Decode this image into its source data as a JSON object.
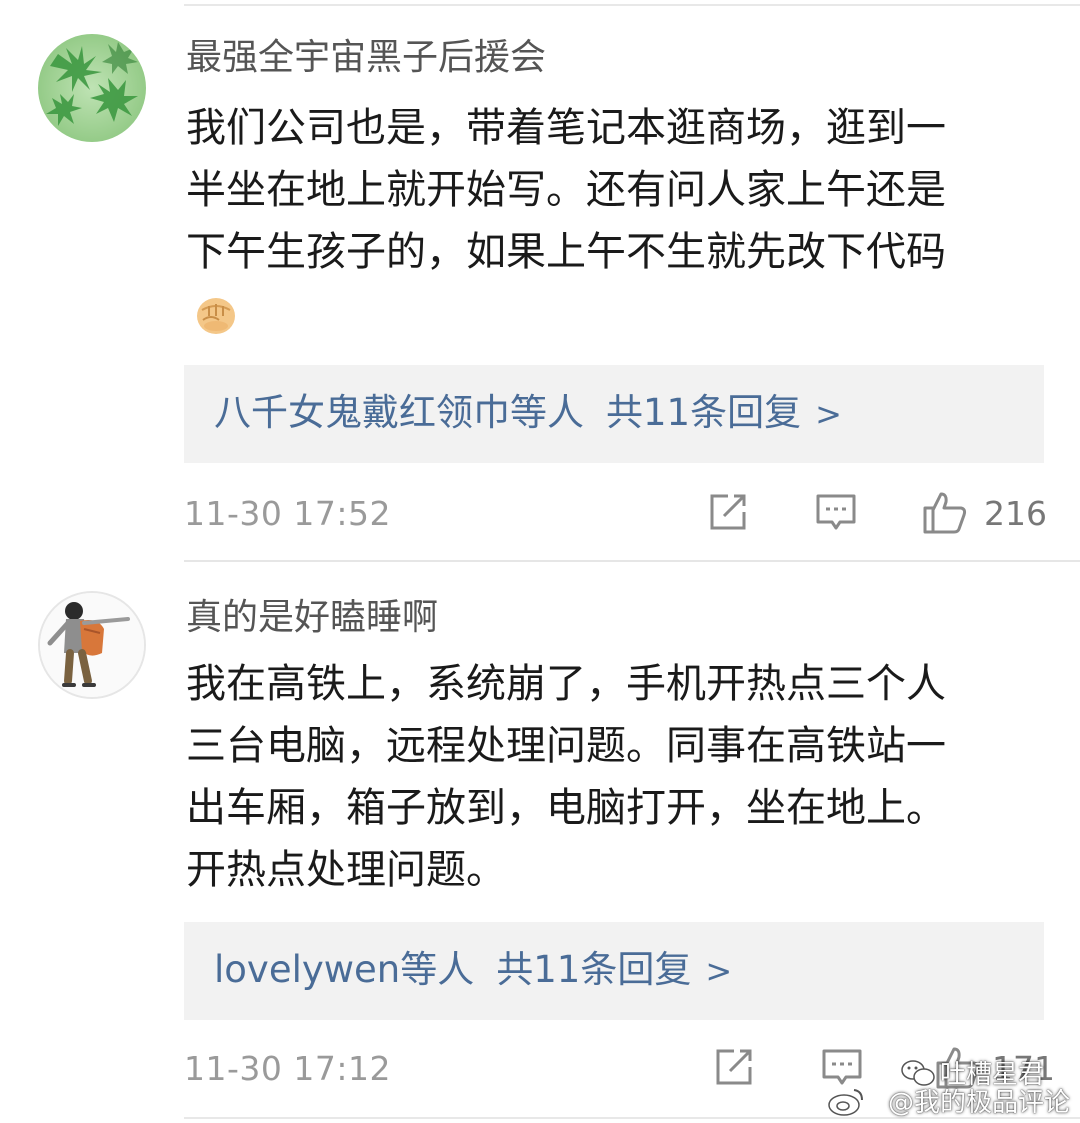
{
  "comments": [
    {
      "username": "最强全宇宙黑子后援会",
      "body_lines": [
        "我们公司也是，带着笔记本逛商场，逛到一",
        "半坐在地上就开始写。还有问人家上午还是",
        "下午生孩子的，如果上午不生就先改下代码"
      ],
      "emoji": "fist-emoji",
      "reply": {
        "names": "八千女鬼戴红领巾",
        "suffix": "等人",
        "count": "共11条回复",
        "chevron": ">"
      },
      "timestamp": "11-30 17:52",
      "likes": "216"
    },
    {
      "username": "真的是好瞌睡啊",
      "body_lines": [
        "我在高铁上，系统崩了，手机开热点三个人",
        "三台电脑，远程处理问题。同事在高铁站一",
        "出车厢，箱子放到，电脑打开，坐在地上。",
        "开热点处理问题。"
      ],
      "reply": {
        "names": "lovelywen",
        "suffix": "等人",
        "count": "共11条回复",
        "chevron": ">"
      },
      "timestamp": "11-30 17:12",
      "likes": "171"
    }
  ],
  "watermark": {
    "line1": "吐槽星君",
    "line2": "@我的极品评论"
  },
  "colors": {
    "link": "#4a6c97",
    "reply_bg": "#f2f2f2",
    "meta": "#9a9a9a",
    "username": "#555555"
  }
}
